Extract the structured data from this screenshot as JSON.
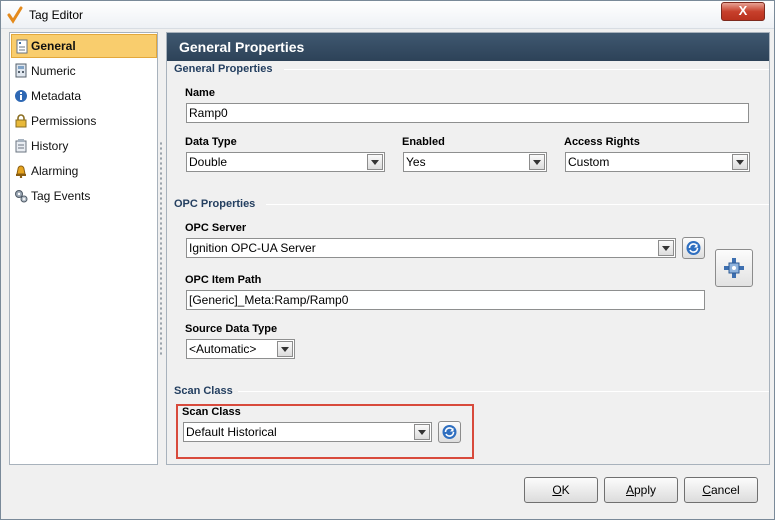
{
  "window": {
    "title": "Tag Editor",
    "close_label": "X"
  },
  "sidebar": {
    "items": [
      {
        "label": "General",
        "icon": "general-icon",
        "active": true
      },
      {
        "label": "Numeric",
        "icon": "numeric-icon",
        "active": false
      },
      {
        "label": "Metadata",
        "icon": "info-icon",
        "active": false
      },
      {
        "label": "Permissions",
        "icon": "lock-icon",
        "active": false
      },
      {
        "label": "History",
        "icon": "history-icon",
        "active": false
      },
      {
        "label": "Alarming",
        "icon": "bell-icon",
        "active": false
      },
      {
        "label": "Tag Events",
        "icon": "gears-icon",
        "active": false
      }
    ]
  },
  "panel": {
    "header": "General Properties",
    "general": {
      "section_title": "General Properties",
      "name_label": "Name",
      "name_value": "Ramp0",
      "data_type_label": "Data Type",
      "data_type_value": "Double",
      "enabled_label": "Enabled",
      "enabled_value": "Yes",
      "access_rights_label": "Access Rights",
      "access_rights_value": "Custom"
    },
    "opc": {
      "section_title": "OPC Properties",
      "server_label": "OPC Server",
      "server_value": "Ignition OPC-UA Server",
      "item_path_label": "OPC Item Path",
      "item_path_value": "[Generic]_Meta:Ramp/Ramp0",
      "source_type_label": "Source Data Type",
      "source_type_value": "<Automatic>"
    },
    "scan": {
      "section_title": "Scan Class",
      "label": "Scan Class",
      "value": "Default Historical"
    }
  },
  "buttons": {
    "ok_mnemonic": "O",
    "ok_rest": "K",
    "apply_mnemonic": "A",
    "apply_rest": "pply",
    "cancel_mnemonic": "C",
    "cancel_rest": "ancel"
  },
  "colors": {
    "header_bg": "#2d4258",
    "active_item": "#f9cd6d",
    "section_text": "#243f60",
    "highlight": "#d84a3c"
  }
}
